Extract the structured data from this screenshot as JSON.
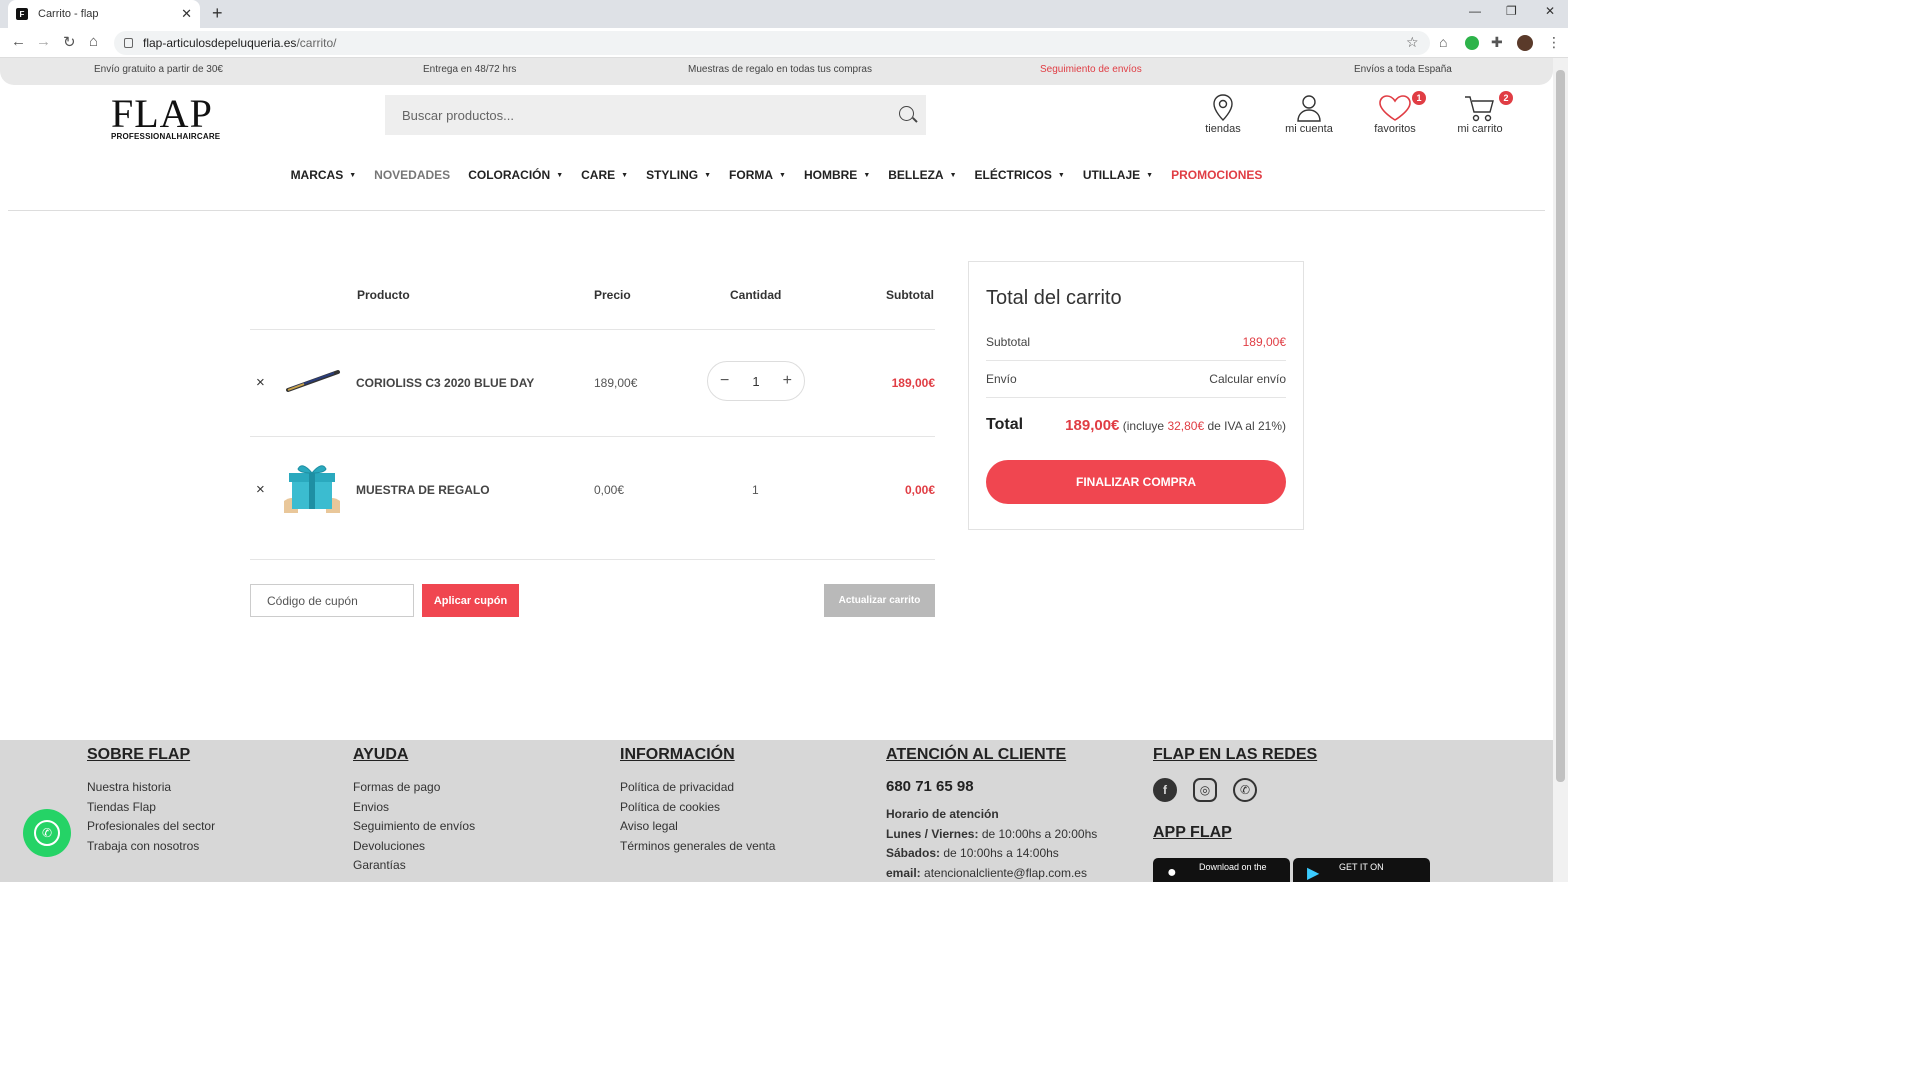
{
  "browser": {
    "tab_title": "Carrito - flap",
    "tab_close": "✕",
    "new_tab": "+",
    "url_domain": "flap-articulosdepeluqueria.es",
    "url_path": "/carrito/"
  },
  "topbar": {
    "shipping": "Envío gratuito a partir de 30€",
    "delivery": "Entrega en 48/72 hrs",
    "samples": "Muestras de regalo en todas tus compras",
    "tracking": "Seguimiento de envíos",
    "spain": "Envíos a toda España"
  },
  "logo": {
    "name": "FLAP",
    "tagline": "PROFESSIONALHAIRCARE"
  },
  "search": {
    "placeholder": "Buscar productos..."
  },
  "header_icons": {
    "stores": "tiendas",
    "account": "mi cuenta",
    "favorites": "favoritos",
    "favorites_count": "1",
    "cart": "mi carrito",
    "cart_count": "2"
  },
  "nav": [
    {
      "label": "MARCAS",
      "dropdown": true
    },
    {
      "label": "NOVEDADES",
      "dropdown": false
    },
    {
      "label": "COLORACIÓN",
      "dropdown": true
    },
    {
      "label": "CARE",
      "dropdown": true
    },
    {
      "label": "STYLING",
      "dropdown": true
    },
    {
      "label": "FORMA",
      "dropdown": true
    },
    {
      "label": "HOMBRE",
      "dropdown": true
    },
    {
      "label": "BELLEZA",
      "dropdown": true
    },
    {
      "label": "ELÉCTRICOS",
      "dropdown": true
    },
    {
      "label": "UTILLAJE",
      "dropdown": true
    },
    {
      "label": "PROMOCIONES",
      "dropdown": false
    }
  ],
  "cart": {
    "headers": {
      "product": "Producto",
      "price": "Precio",
      "quantity": "Cantidad",
      "subtotal": "Subtotal"
    },
    "remove_symbol": "×",
    "items": [
      {
        "name": "CORIOLISS C3 2020 BLUE DAY",
        "price": "189,00€",
        "quantity": "1",
        "subtotal": "189,00€",
        "minus": "−",
        "plus": "+"
      },
      {
        "name": "MUESTRA DE REGALO",
        "price": "0,00€",
        "quantity": "1",
        "subtotal": "0,00€"
      }
    ],
    "coupon_placeholder": "Código de cupón",
    "apply_coupon": "Aplicar cupón",
    "update_cart": "Actualizar carrito"
  },
  "totals": {
    "title": "Total del carrito",
    "subtotal_label": "Subtotal",
    "subtotal_value": "189,00€",
    "shipping_label": "Envío",
    "shipping_value": "Calcular envío",
    "total_label": "Total",
    "total_value": "189,00€",
    "tax_prefix": "(incluye",
    "tax_amount": "32,80€",
    "tax_suffix": "de IVA al 21%)",
    "checkout": "FINALIZAR COMPRA"
  },
  "footer": {
    "about": {
      "title": "SOBRE FLAP",
      "links": [
        "Nuestra historia",
        "Tiendas Flap",
        "Profesionales del sector",
        "Trabaja con nosotros"
      ]
    },
    "help": {
      "title": "AYUDA",
      "links": [
        "Formas de pago",
        "Envios",
        "Seguimiento de envíos",
        "Devoluciones",
        "Garantías"
      ]
    },
    "info": {
      "title": "INFORMACIÓN",
      "links": [
        "Política de privacidad",
        "Política de cookies",
        "Aviso legal",
        "Términos generales de venta"
      ]
    },
    "support": {
      "title": "ATENCIÓN AL CLIENTE",
      "phone": "680 71 65 98",
      "hours_title": "Horario de atención",
      "weekdays_label": "Lunes / Viernes:",
      "weekdays_value": "de 10:00hs a 20:00hs",
      "saturday_label": "Sábados:",
      "saturday_value": "de 10:00hs a 14:00hs",
      "email_label": "email:",
      "email_value": "atencionalcliente@flap.com.es"
    },
    "social": {
      "title": "FLAP EN LAS REDES",
      "app_title": "APP FLAP",
      "app_store": "Download on the",
      "google_play": "GET IT ON"
    }
  },
  "colors": {
    "accent": "#e03d44",
    "button": "#f04650",
    "whatsapp": "#25d366",
    "footer_bg": "#d7d7d7"
  }
}
